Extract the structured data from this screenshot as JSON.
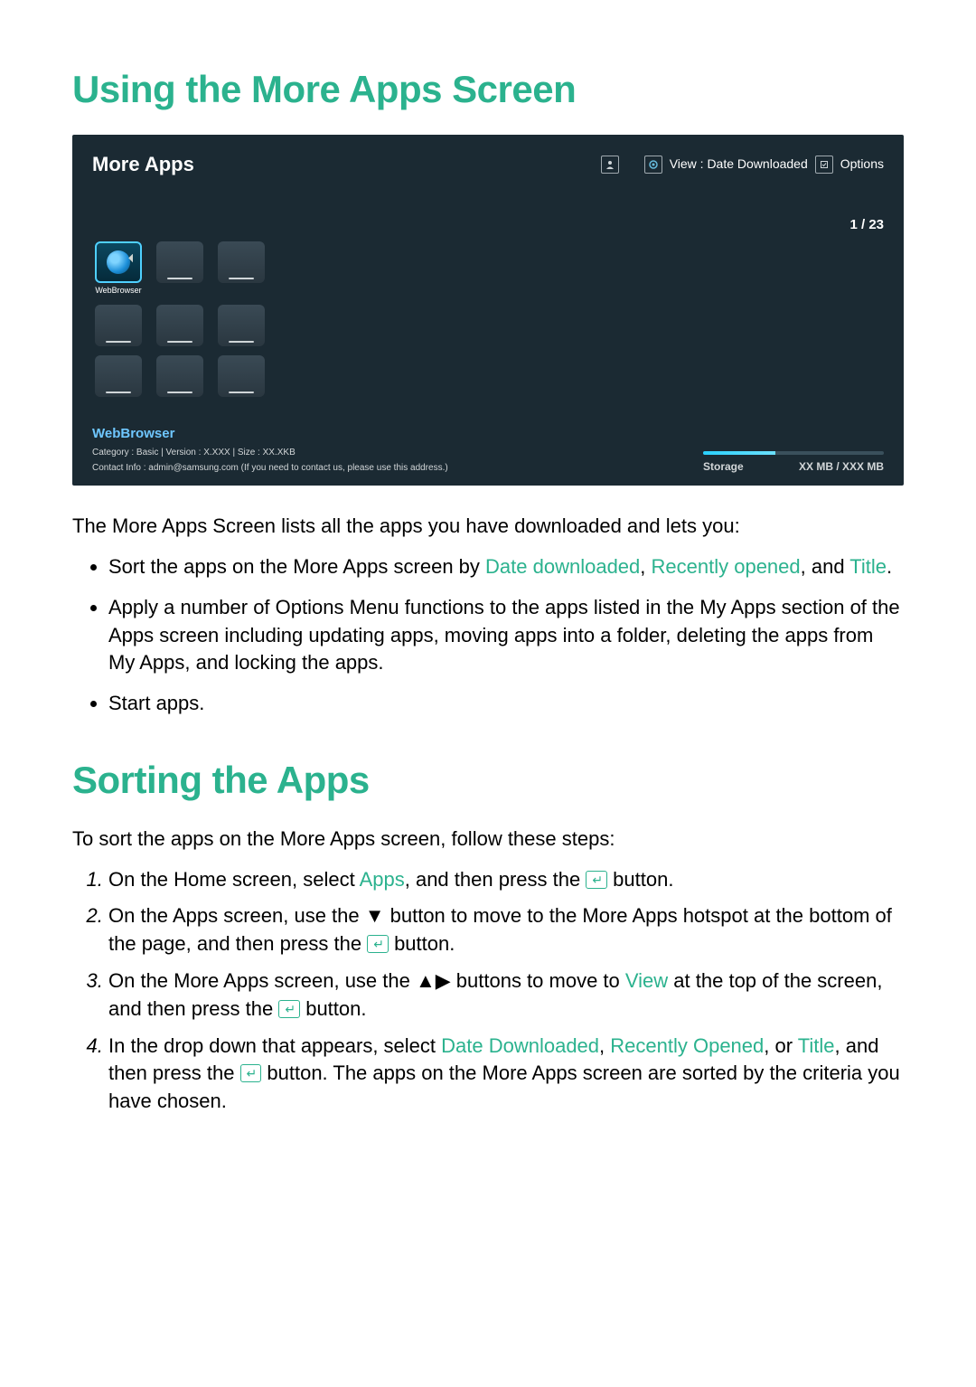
{
  "heading1": "Using the More Apps Screen",
  "screenshot": {
    "title": "More Apps",
    "view_label": "View : Date Downloaded",
    "options_label": "Options",
    "page_count": "1 / 23",
    "app_name": "WebBrowser",
    "info_name": "WebBrowser",
    "info_meta": "Category : Basic  |  Version : X.XXX  |  Size : XX.XKB",
    "info_contact": "Contact Info : admin@samsung.com (If you need to contact us, please use this address.)",
    "storage_label": "Storage",
    "storage_value": "XX MB / XXX MB"
  },
  "intro": "The More Apps Screen lists all the apps you have downloaded and lets you:",
  "bullets": {
    "b1_pre": "Sort the apps on the More Apps screen by ",
    "b1_date": "Date downloaded",
    "b1_sep1": ", ",
    "b1_recent": "Recently opened",
    "b1_sep2": ", and ",
    "b1_title": "Title",
    "b1_post": ".",
    "b2": "Apply a number of Options Menu functions to the apps listed in the My Apps section of the Apps screen including updating apps, moving apps into a folder, deleting the apps from My Apps, and locking the apps.",
    "b3": "Start apps."
  },
  "heading2": "Sorting the Apps",
  "sort_intro": "To sort the apps on the More Apps screen, follow these steps:",
  "steps": {
    "s1_pre": "On the Home screen, select ",
    "s1_apps": "Apps",
    "s1_mid": ", and then press the ",
    "s1_btn": "↵",
    "s1_post": " button.",
    "s2_pre": "On the Apps screen, use the ▼ button to move to the More Apps hotspot at the bottom of the page, and then press the ",
    "s2_btn": "↵",
    "s2_post": " button.",
    "s3_pre": "On the More Apps screen, use the ▲▶ buttons to move to ",
    "s3_view": "View",
    "s3_mid": " at the top of the screen, and then press the ",
    "s3_btn": "↵",
    "s3_post": " button.",
    "s4_pre": "In the drop down that appears, select ",
    "s4_date": "Date Downloaded",
    "s4_sep1": ", ",
    "s4_recent": "Recently Opened",
    "s4_sep2": ", or ",
    "s4_title": "Title",
    "s4_mid": ", and then press the ",
    "s4_btn": "↵",
    "s4_post": " button. The apps on the More Apps screen are sorted by the criteria you have chosen."
  }
}
